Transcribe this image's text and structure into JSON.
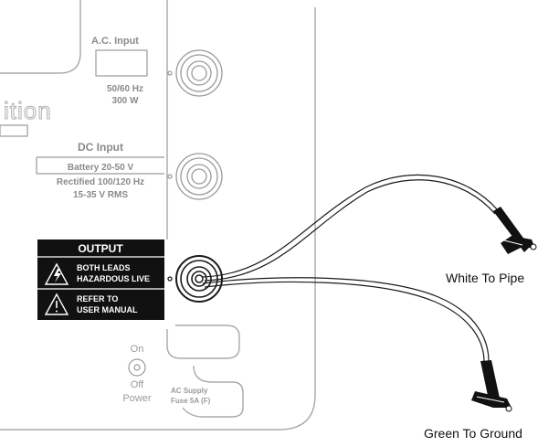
{
  "panel": {
    "ac_input": {
      "title": "A.C. Input",
      "line1": "50/60 Hz",
      "line2": "300 W"
    },
    "brand_fragment": "ition",
    "dc_input": {
      "title": "DC Input",
      "line1": "Battery 20-50 V",
      "line2": "Rectified 100/120 Hz",
      "line3": "15-35 V RMS"
    },
    "output": {
      "title": "OUTPUT",
      "warning1_line1": "BOTH LEADS",
      "warning1_line2": "HAZARDOUS LIVE",
      "warning2_line1": "REFER TO",
      "warning2_line2": "USER MANUAL"
    },
    "power": {
      "on": "On",
      "off": "Off",
      "label": "Power"
    },
    "fuse": {
      "line1": "AC Supply",
      "line2": "Fuse 5A (F)"
    }
  },
  "leads": {
    "white": "White To Pipe",
    "green": "Green To Ground"
  },
  "colors": {
    "line": "#9a9a9a",
    "text_gray": "#8a8a8a",
    "output_panel": "#111111",
    "text_dark": "#111111"
  },
  "icons": [
    "warning-triangle-icon",
    "power-switch-icon",
    "jack-socket-icon",
    "alligator-clip-icon"
  ]
}
